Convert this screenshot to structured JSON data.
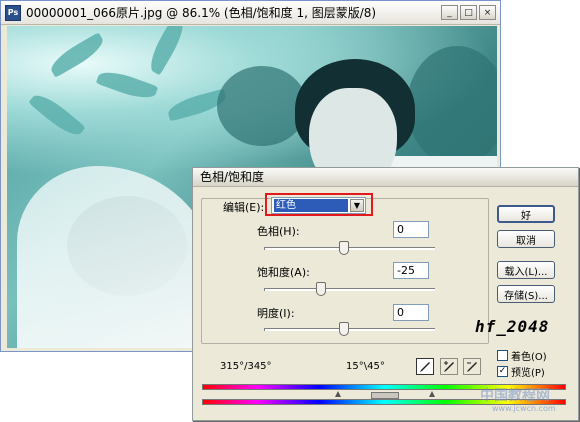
{
  "document": {
    "title": "00000001_066原片.jpg @ 86.1% (色相/饱和度 1, 图层蒙版/8)",
    "app_icon_label": "Ps",
    "minimize_glyph": "_",
    "maximize_glyph": "□",
    "close_glyph": "×"
  },
  "dialog": {
    "title": "色相/饱和度",
    "edit_label": "编辑(E):",
    "edit_value": "红色",
    "edit_arrow": "▼",
    "sliders": [
      {
        "label": "色相(H):",
        "value": "0",
        "level": 0
      },
      {
        "label": "饱和度(A):",
        "value": "-25",
        "level": -25
      },
      {
        "label": "明度(I):",
        "value": "0",
        "level": 0
      }
    ],
    "buttons": {
      "ok": "好",
      "cancel": "取消",
      "load": "载入(L)...",
      "save": "存储(S)..."
    },
    "logo_text": "hf_2048",
    "colorize_label": "着色(O)",
    "colorize_checked": false,
    "preview_label": "预览(P)",
    "preview_checked": true,
    "check_mark": "✓",
    "range_left": "315°/345°",
    "range_right": "15°\\45°"
  },
  "watermark": {
    "main": "中国教程网",
    "sub": "www.jcwcn.com"
  },
  "colors": {
    "selection_highlight": "#e3191c",
    "dropdown_selected": "#2c5bb8"
  }
}
